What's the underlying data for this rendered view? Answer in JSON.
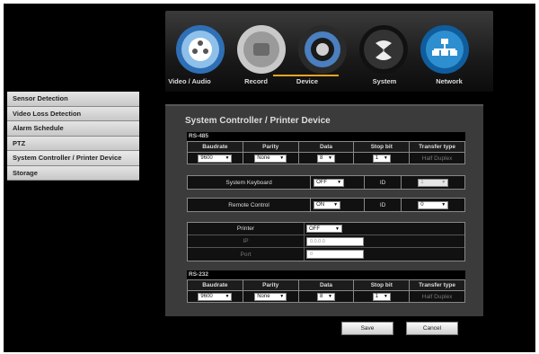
{
  "nav": {
    "items": [
      {
        "label": "Video / Audio",
        "icon": "video-audio-icon"
      },
      {
        "label": "Record",
        "icon": "record-icon"
      },
      {
        "label": "Device",
        "icon": "device-icon"
      },
      {
        "label": "System",
        "icon": "system-icon"
      },
      {
        "label": "Network",
        "icon": "network-icon"
      }
    ],
    "active": "Device",
    "accent": "#e8a423"
  },
  "sidebar": {
    "items": [
      {
        "label": "Sensor Detection"
      },
      {
        "label": "Video Loss Detection"
      },
      {
        "label": "Alarm Schedule"
      },
      {
        "label": "PTZ"
      },
      {
        "label": "System Controller / Printer Device"
      },
      {
        "label": "Storage"
      }
    ]
  },
  "panel": {
    "title": "System Controller / Printer Device",
    "rs485": {
      "title": "RS-485",
      "headers": [
        "Baudrate",
        "Parity",
        "Data",
        "Stop bit",
        "Transfer type"
      ],
      "values": {
        "baudrate": "9600",
        "parity": "None",
        "data": "8",
        "stop_bit": "1",
        "transfer_type": "Half Duplex"
      }
    },
    "keyboard": {
      "label": "System Keyboard",
      "value": "OFF",
      "id_label": "ID",
      "id_value": "1"
    },
    "remote": {
      "label": "Remote Control",
      "value": "ON",
      "id_label": "ID",
      "id_value": "0"
    },
    "printer": {
      "label": "Printer",
      "value": "OFF",
      "ip_label": "IP",
      "ip_value": "0.0.0.0",
      "port_label": "Port",
      "port_value": "0"
    },
    "rs232": {
      "title": "RS-232",
      "headers": [
        "Baudrate",
        "Parity",
        "Data",
        "Stop bit",
        "Transfer type"
      ],
      "values": {
        "baudrate": "9600",
        "parity": "None",
        "data": "8",
        "stop_bit": "1",
        "transfer_type": "Half Duplex"
      }
    },
    "buttons": {
      "save": "Save",
      "cancel": "Cancel"
    }
  }
}
